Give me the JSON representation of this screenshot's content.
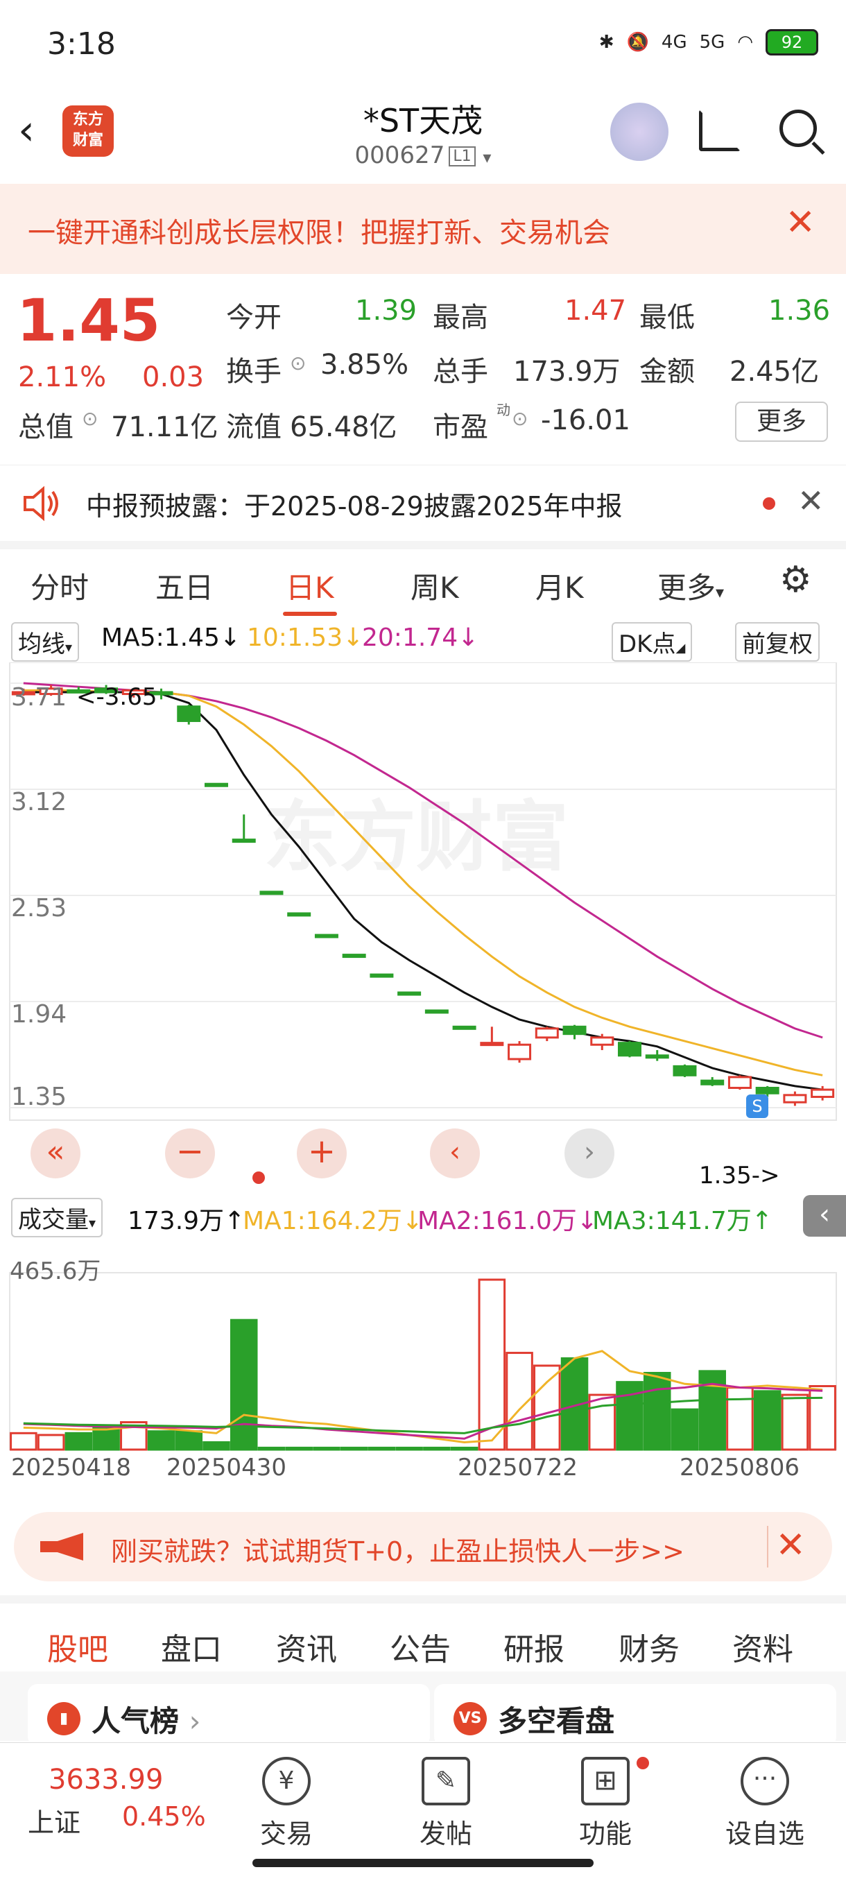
{
  "status": {
    "time": "3:18",
    "net1": "4G",
    "net2": "5G",
    "battery": "92"
  },
  "header": {
    "logo": "东方\n财富",
    "title": "*ST天茂",
    "code": "000627",
    "level": "L1"
  },
  "promo": {
    "text": "一键开通科创成长层权限！把握打新、交易机会",
    "close": "✕"
  },
  "quote": {
    "price": "1.45",
    "pct": "2.11%",
    "change": "0.03",
    "open_label": "今开",
    "open": "1.39",
    "high_label": "最高",
    "high": "1.47",
    "low_label": "最低",
    "low": "1.36",
    "turnover_label": "换手",
    "turnover": "3.85%",
    "volume_label": "总手",
    "volume": "173.9万",
    "amount_label": "金额",
    "amount": "2.45亿",
    "mktcap_label": "总值",
    "mktcap": "71.11亿",
    "float_label": "流值",
    "float": "65.48亿",
    "pe_label": "市盈",
    "pe_sup": "动",
    "pe": "-16.01",
    "more": "更多"
  },
  "notice": {
    "text": "中报预披露：于2025-08-29披露2025年中报",
    "close": "✕"
  },
  "tabs": [
    "分时",
    "五日",
    "日K",
    "周K",
    "月K",
    "更多"
  ],
  "kline": {
    "ma_selector": "均线",
    "ma5": "MA5:1.45",
    "ma10": "10:1.53",
    "ma20": "20:1.74",
    "dk": "DK点",
    "adjust": "前复权",
    "high_marker": "<-3.65",
    "low_marker": "1.35->",
    "s_marker": "S",
    "vol_selector": "成交量",
    "vol": "173.9万",
    "vol_ma1": "MA1:164.2万",
    "vol_ma2": "MA2:161.0万",
    "vol_ma3": "MA3:141.7万",
    "vol_max": "465.6万",
    "date_labels": [
      "20250418",
      "20250430",
      "20250722",
      "20250806"
    ]
  },
  "chart_data": {
    "type": "candlestick",
    "y_ticks": [
      3.71,
      3.12,
      2.53,
      1.94,
      1.35
    ],
    "ylim": [
      1.35,
      3.71
    ],
    "candles": [
      {
        "o": 3.66,
        "c": 3.66,
        "h": 3.68,
        "l": 3.64,
        "up": true
      },
      {
        "o": 3.65,
        "c": 3.68,
        "h": 3.7,
        "l": 3.64,
        "up": true
      },
      {
        "o": 3.67,
        "c": 3.67,
        "h": 3.69,
        "l": 3.66,
        "up": false
      },
      {
        "o": 3.68,
        "c": 3.66,
        "h": 3.7,
        "l": 3.65,
        "up": false
      },
      {
        "o": 3.65,
        "c": 3.67,
        "h": 3.68,
        "l": 3.63,
        "up": true
      },
      {
        "o": 3.66,
        "c": 3.65,
        "h": 3.68,
        "l": 3.62,
        "up": false
      },
      {
        "o": 3.58,
        "c": 3.5,
        "h": 3.59,
        "l": 3.48,
        "up": false
      },
      {
        "o": 3.15,
        "c": 3.15,
        "h": 3.15,
        "l": 3.15,
        "up": false
      },
      {
        "o": 2.84,
        "c": 2.84,
        "h": 2.98,
        "l": 2.84,
        "up": false
      },
      {
        "o": 2.55,
        "c": 2.55,
        "h": 2.55,
        "l": 2.55,
        "up": false
      },
      {
        "o": 2.43,
        "c": 2.43,
        "h": 2.43,
        "l": 2.43,
        "up": false
      },
      {
        "o": 2.31,
        "c": 2.31,
        "h": 2.31,
        "l": 2.31,
        "up": false
      },
      {
        "o": 2.2,
        "c": 2.2,
        "h": 2.2,
        "l": 2.2,
        "up": false
      },
      {
        "o": 2.09,
        "c": 2.09,
        "h": 2.09,
        "l": 2.09,
        "up": false
      },
      {
        "o": 1.99,
        "c": 1.99,
        "h": 1.99,
        "l": 1.99,
        "up": false
      },
      {
        "o": 1.89,
        "c": 1.89,
        "h": 1.89,
        "l": 1.89,
        "up": false
      },
      {
        "o": 1.8,
        "c": 1.8,
        "h": 1.8,
        "l": 1.8,
        "up": false
      },
      {
        "o": 1.71,
        "c": 1.71,
        "h": 1.8,
        "l": 1.7,
        "up": true
      },
      {
        "o": 1.62,
        "c": 1.7,
        "h": 1.72,
        "l": 1.6,
        "up": true
      },
      {
        "o": 1.74,
        "c": 1.79,
        "h": 1.8,
        "l": 1.72,
        "up": true
      },
      {
        "o": 1.8,
        "c": 1.76,
        "h": 1.81,
        "l": 1.73,
        "up": false
      },
      {
        "o": 1.7,
        "c": 1.74,
        "h": 1.76,
        "l": 1.67,
        "up": true
      },
      {
        "o": 1.71,
        "c": 1.64,
        "h": 1.72,
        "l": 1.63,
        "up": false
      },
      {
        "o": 1.64,
        "c": 1.63,
        "h": 1.67,
        "l": 1.61,
        "up": false
      },
      {
        "o": 1.58,
        "c": 1.53,
        "h": 1.59,
        "l": 1.52,
        "up": false
      },
      {
        "o": 1.5,
        "c": 1.48,
        "h": 1.52,
        "l": 1.47,
        "up": false
      },
      {
        "o": 1.46,
        "c": 1.52,
        "h": 1.53,
        "l": 1.45,
        "up": true
      },
      {
        "o": 1.46,
        "c": 1.43,
        "h": 1.47,
        "l": 1.41,
        "up": false
      },
      {
        "o": 1.38,
        "c": 1.42,
        "h": 1.44,
        "l": 1.36,
        "up": true
      },
      {
        "o": 1.41,
        "c": 1.45,
        "h": 1.47,
        "l": 1.39,
        "up": true
      }
    ],
    "ma5": [
      3.66,
      3.66,
      3.66,
      3.66,
      3.66,
      3.65,
      3.6,
      3.45,
      3.2,
      2.98,
      2.8,
      2.6,
      2.4,
      2.27,
      2.17,
      2.08,
      1.99,
      1.91,
      1.84,
      1.8,
      1.77,
      1.74,
      1.72,
      1.69,
      1.63,
      1.57,
      1.53,
      1.5,
      1.47,
      1.45
    ],
    "ma10": [
      3.67,
      3.67,
      3.67,
      3.66,
      3.66,
      3.66,
      3.64,
      3.58,
      3.48,
      3.36,
      3.22,
      3.06,
      2.9,
      2.74,
      2.58,
      2.44,
      2.31,
      2.19,
      2.08,
      1.99,
      1.91,
      1.85,
      1.8,
      1.76,
      1.72,
      1.68,
      1.64,
      1.6,
      1.56,
      1.53
    ],
    "ma20": [
      3.71,
      3.7,
      3.69,
      3.68,
      3.67,
      3.66,
      3.64,
      3.61,
      3.57,
      3.52,
      3.46,
      3.39,
      3.31,
      3.22,
      3.13,
      3.03,
      2.93,
      2.82,
      2.71,
      2.6,
      2.49,
      2.39,
      2.29,
      2.19,
      2.1,
      2.01,
      1.93,
      1.86,
      1.79,
      1.74
    ],
    "volumes": [
      45,
      40,
      45,
      60,
      75,
      50,
      50,
      20,
      355,
      5,
      5,
      5,
      5,
      5,
      5,
      5,
      5,
      465.6,
      265,
      230,
      250,
      150,
      185,
      210,
      110,
      215,
      170,
      160,
      150,
      173.9
    ],
    "vol_ma1": [
      60,
      58,
      55,
      55,
      62,
      58,
      52,
      45,
      95,
      85,
      75,
      70,
      60,
      50,
      40,
      30,
      20,
      25,
      110,
      185,
      250,
      270,
      215,
      200,
      180,
      175,
      170,
      175,
      170,
      164.2
    ],
    "vol_ma2": [
      70,
      68,
      65,
      63,
      62,
      61,
      60,
      58,
      70,
      65,
      62,
      55,
      50,
      45,
      40,
      35,
      30,
      60,
      80,
      100,
      120,
      140,
      150,
      165,
      170,
      180,
      170,
      168,
      164,
      161.0
    ],
    "vol_ma3": [
      72,
      70,
      68,
      67,
      66,
      65,
      64,
      62,
      64,
      62,
      60,
      58,
      55,
      52,
      50,
      47,
      45,
      60,
      70,
      90,
      105,
      120,
      125,
      128,
      133,
      137,
      138,
      140,
      141,
      141.7
    ]
  },
  "colors": {
    "up": "#e03c31",
    "down": "#2aa02a",
    "ma5": "#111111",
    "ma10": "#f0b429",
    "ma20": "#c2278f",
    "vma1": "#f0b429",
    "vma2": "#c2278f",
    "vma3": "#2aa02a",
    "accent": "#e2462a"
  },
  "ad": {
    "text": "刚买就跌？试试期货T+0，止盈止损快人一步>>",
    "close": "✕"
  },
  "subtabs": [
    "股吧",
    "盘口",
    "资讯",
    "公告",
    "研报",
    "财务",
    "资料"
  ],
  "cards": {
    "popular": "人气榜",
    "bullbear": "多空看盘"
  },
  "bottom": {
    "index_value": "3633.99",
    "index_name": "上证",
    "index_pct": "0.45%",
    "nav": [
      "交易",
      "发帖",
      "功能",
      "设自选"
    ]
  }
}
